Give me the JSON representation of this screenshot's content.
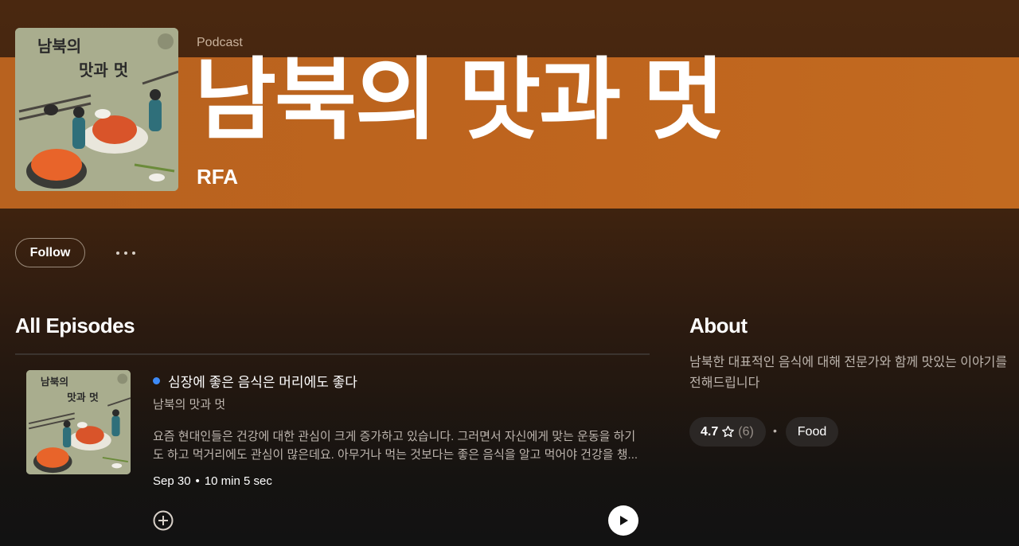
{
  "header": {
    "type_label": "Podcast",
    "title": "남북의 맛과 멋",
    "publisher": "RFA",
    "cover_text_line1": "남북의",
    "cover_text_line2": "맛과 멋"
  },
  "actions": {
    "follow_label": "Follow",
    "more_icon": "ellipsis-icon"
  },
  "episodes_section": {
    "title": "All Episodes",
    "episodes": [
      {
        "title": "심장에 좋은 음식은 머리에도 좋다",
        "show": "남북의 맛과 멋",
        "description": "요즘 현대인들은 건강에 대한 관심이 크게 증가하고 있습니다. 그러면서 자신에게 맞는 운동을 하기도 하고 먹거리에도 관심이 많은데요. 아무거나 먹는 것보다는 좋은 음식을 알고 먹어야 건강을 챙...",
        "date": "Sep 30",
        "separator": "•",
        "duration": "10 min 5 sec",
        "is_new": true
      }
    ]
  },
  "about": {
    "title": "About",
    "description": "남북한 대표적인 음식에 대해 전문가와 함께 맛있는 이야기를 전해드립니다",
    "rating": "4.7",
    "rating_count": "(6)",
    "bullet": "•",
    "category": "Food"
  },
  "colors": {
    "header_band": "#bf651e",
    "background": "#121212",
    "new_dot": "#3d8af7",
    "muted_text": "#bdb5ae"
  }
}
